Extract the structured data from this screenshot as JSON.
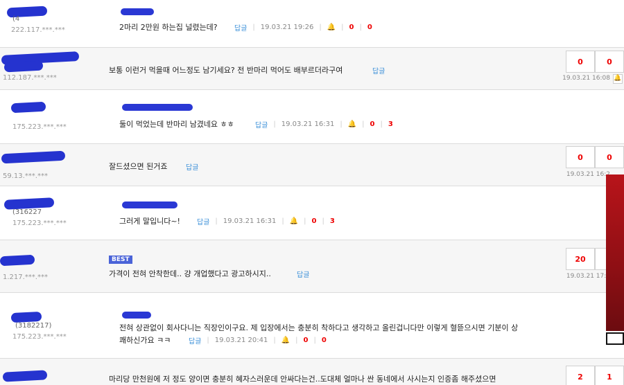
{
  "comments": [
    {
      "ip": "222.117.***.***",
      "text": "2마리 2만원 하는집 널렸는데?",
      "reply": "답글",
      "date": "19.03.21 19:26",
      "up": "0",
      "down": "0",
      "nested": true
    },
    {
      "ip": "112.187.***.***",
      "text": "보통 이런거 먹을때 어느정도 남기세요? 전 반마리 먹어도 배부르더라구여",
      "reply": "답글",
      "date": "19.03.21 16:08",
      "up": "0",
      "down": "0",
      "nested": false
    },
    {
      "ip": "175.223.***.***",
      "text": "둘이 먹었는데 반마리 남겼네요 ㅎㅎ",
      "reply": "답글",
      "date": "19.03.21 16:31",
      "up": "0",
      "down": "3",
      "nested": true
    },
    {
      "ip": "59.13.***.***",
      "text": "잘드셨으면 된거죠",
      "reply": "답글",
      "date": "19.03.21 16:2",
      "up": "0",
      "down": "0",
      "nested": false
    },
    {
      "ip": "175.223.***.***",
      "text": "그러게 말입니다~!",
      "reply": "답글",
      "date": "19.03.21 16:31",
      "up": "0",
      "down": "3",
      "nested": true
    },
    {
      "ip": "1.217.***.***",
      "text": "가격이 전혀 안착한데.. 걍 개업했다고 광고하시지..",
      "reply": "답글",
      "date": "19.03.21 17:0",
      "up": "20",
      "down": "",
      "nested": false,
      "badge": "BEST"
    },
    {
      "ip": "175.223.***.***",
      "text": "전혀 상관없이 회사다니는 직장인이구요. 제 입장에서는 충분히 착하다고 생각하고 올린겁니다만 이렇게 혈뜯으시면 기분이 상",
      "text2": "쾌하신가요 ㅋㅋ",
      "reply": "답글",
      "date": "19.03.21 20:41",
      "up": "0",
      "down": "0",
      "nested": true,
      "uname": "(3182217)"
    },
    {
      "ip": "",
      "text": "마리당 만천원에 저 정도 양이면 충분히 혜자스러운데 안싸다는건..도대체 얼마나 싼 동네에서 사시는지 인증좀 해주셨으면",
      "reply": "",
      "date": "",
      "up": "2",
      "down": "1",
      "nested": false
    }
  ],
  "colors": {
    "accent": "#3a8fd8",
    "vote": "#e00000",
    "best": "#4a63d8"
  }
}
